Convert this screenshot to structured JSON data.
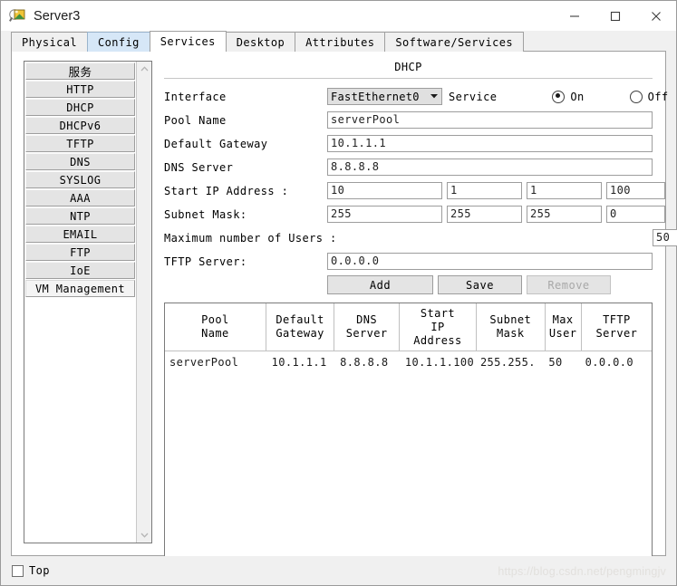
{
  "window": {
    "title": "Server3",
    "icon": "packet-tracer-server-icon",
    "minimize_label": "—",
    "maximize_label": "□",
    "close_label": "✕"
  },
  "tabs": [
    {
      "label": "Physical",
      "state": "normal"
    },
    {
      "label": "Config",
      "state": "hover"
    },
    {
      "label": "Services",
      "state": "active"
    },
    {
      "label": "Desktop",
      "state": "normal"
    },
    {
      "label": "Attributes",
      "state": "normal"
    },
    {
      "label": "Software/Services",
      "state": "normal"
    }
  ],
  "sidebar": {
    "items": [
      {
        "label": "服务",
        "cjk": true,
        "selected": false
      },
      {
        "label": "HTTP",
        "selected": false
      },
      {
        "label": "DHCP",
        "selected": false
      },
      {
        "label": "DHCPv6",
        "selected": false
      },
      {
        "label": "TFTP",
        "selected": false
      },
      {
        "label": "DNS",
        "selected": false
      },
      {
        "label": "SYSLOG",
        "selected": false
      },
      {
        "label": "AAA",
        "selected": false
      },
      {
        "label": "NTP",
        "selected": false
      },
      {
        "label": "EMAIL",
        "selected": false
      },
      {
        "label": "FTP",
        "selected": false
      },
      {
        "label": "IoE",
        "selected": false
      },
      {
        "label": "VM Management",
        "selected": true
      }
    ],
    "scroll_up": "▲",
    "scroll_down": "▼"
  },
  "panel": {
    "title": "DHCP",
    "interface": {
      "label": "Interface",
      "value": "FastEthernet0",
      "caret": "▼"
    },
    "service": {
      "label": "Service",
      "on_label": "On",
      "off_label": "Off",
      "selected": "On"
    },
    "pool_name": {
      "label": "Pool Name",
      "value": "serverPool"
    },
    "default_gateway": {
      "label": "Default Gateway",
      "value": "10.1.1.1"
    },
    "dns_server": {
      "label": "DNS Server",
      "value": "8.8.8.8"
    },
    "start_ip": {
      "label": "Start IP Address :",
      "octets": [
        "10",
        "1",
        "1",
        "100"
      ]
    },
    "subnet_mask": {
      "label": "Subnet Mask:",
      "octets": [
        "255",
        "255",
        "255",
        "0"
      ]
    },
    "max_users": {
      "label": "Maximum number of Users :",
      "value": "50"
    },
    "tftp_server": {
      "label": "TFTP Server:",
      "value": "0.0.0.0"
    },
    "buttons": {
      "add": "Add",
      "save": "Save",
      "remove": "Remove"
    }
  },
  "table": {
    "headers": [
      "Pool\nName",
      "Default\nGateway",
      "DNS\nServer",
      "Start\nIP\nAddress",
      "Subnet\nMask",
      "Max\nUser",
      "TFTP\nServer"
    ],
    "header_lines": [
      [
        "Pool",
        "Name"
      ],
      [
        "Default",
        "Gateway"
      ],
      [
        "DNS",
        "Server"
      ],
      [
        "Start",
        "IP",
        "Address"
      ],
      [
        "Subnet",
        "Mask"
      ],
      [
        "Max",
        "User"
      ],
      [
        "TFTP",
        "Server"
      ]
    ],
    "rows": [
      {
        "pool_name": "serverPool",
        "default_gateway": "10.1.1.1",
        "dns_server": "8.8.8.8",
        "start_ip_address": "10.1.1.100",
        "subnet_mask": "255.255. ···",
        "max_user": "50",
        "tftp_server": "0.0.0.0"
      }
    ]
  },
  "footer": {
    "top_label": "Top",
    "top_checked": false,
    "watermark": "https://blog.csdn.net/pengmingjv"
  }
}
